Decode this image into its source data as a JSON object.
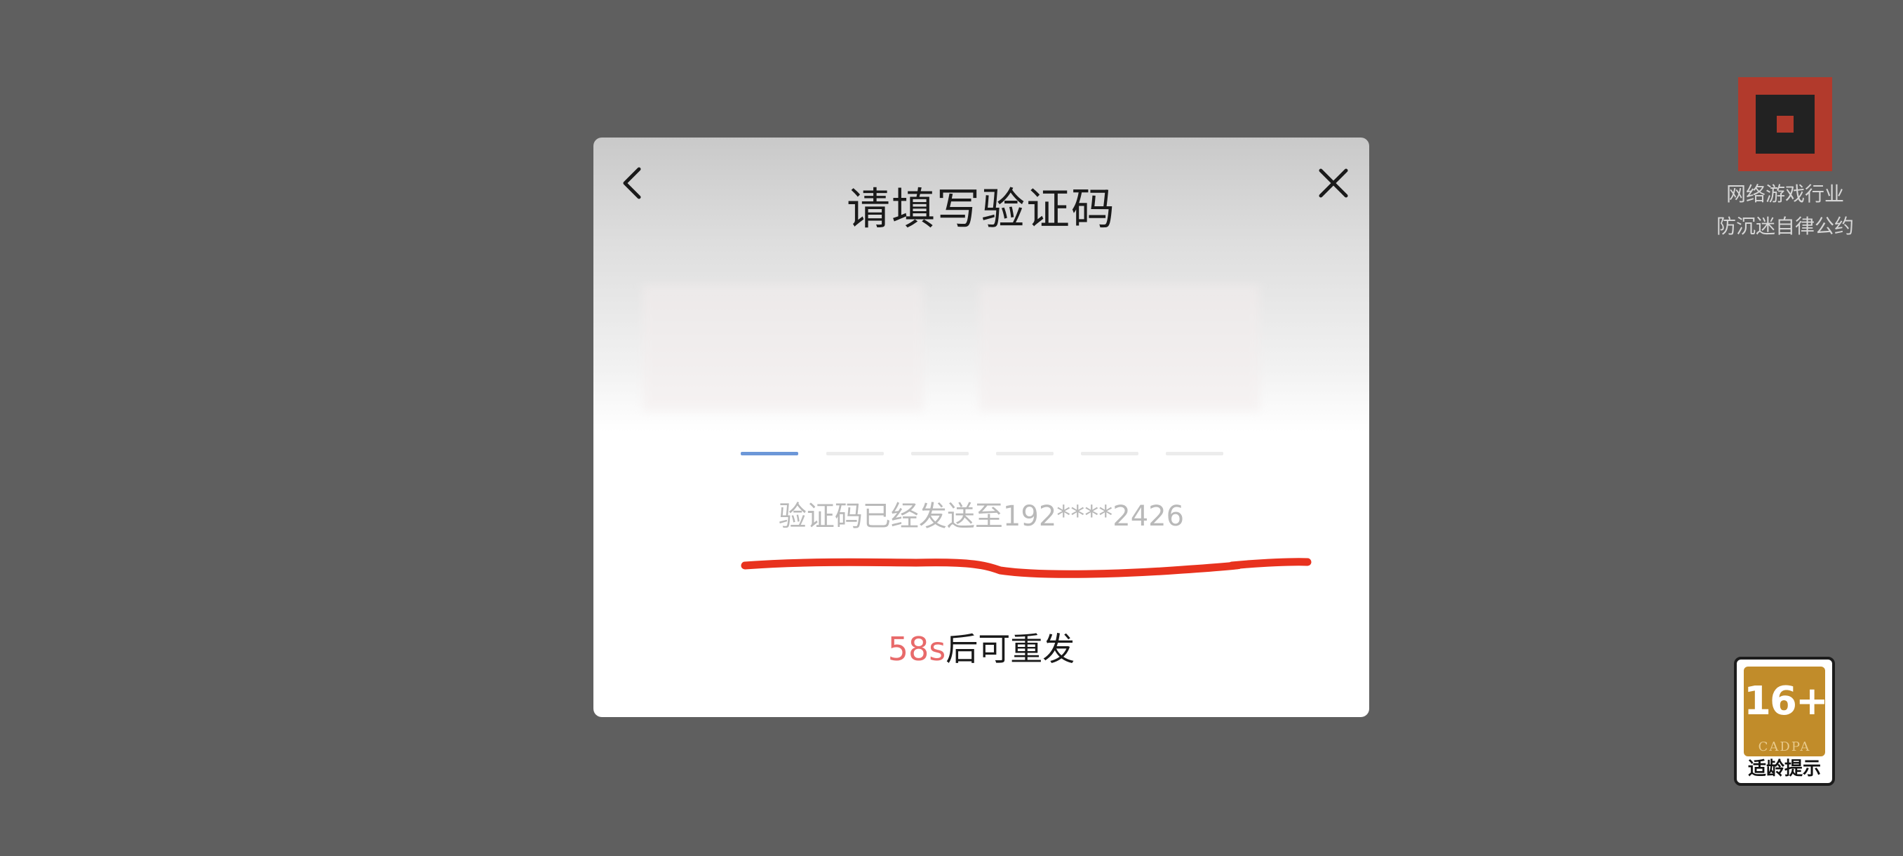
{
  "dialog": {
    "title": "请填写验证码",
    "back_icon": "chevron-left-icon",
    "close_icon": "close-icon",
    "code_slots": 6,
    "active_slot_index": 0,
    "sent_message": "验证码已经发送至192****2426",
    "resend_countdown": "58s",
    "resend_suffix": "后可重发",
    "colors": {
      "active_slot": "#6c97d8",
      "countdown": "#e86a6a",
      "annotation_stroke": "#e8321e"
    }
  },
  "pledge_badge": {
    "icon": "anti-addiction-pledge-logo",
    "line1": "网络游戏行业",
    "line2": "防沉迷自律公约"
  },
  "age_rating": {
    "rating": "16+",
    "org": "CADPA",
    "label": "适龄提示",
    "colors": {
      "badge": "#c18c2a"
    }
  }
}
